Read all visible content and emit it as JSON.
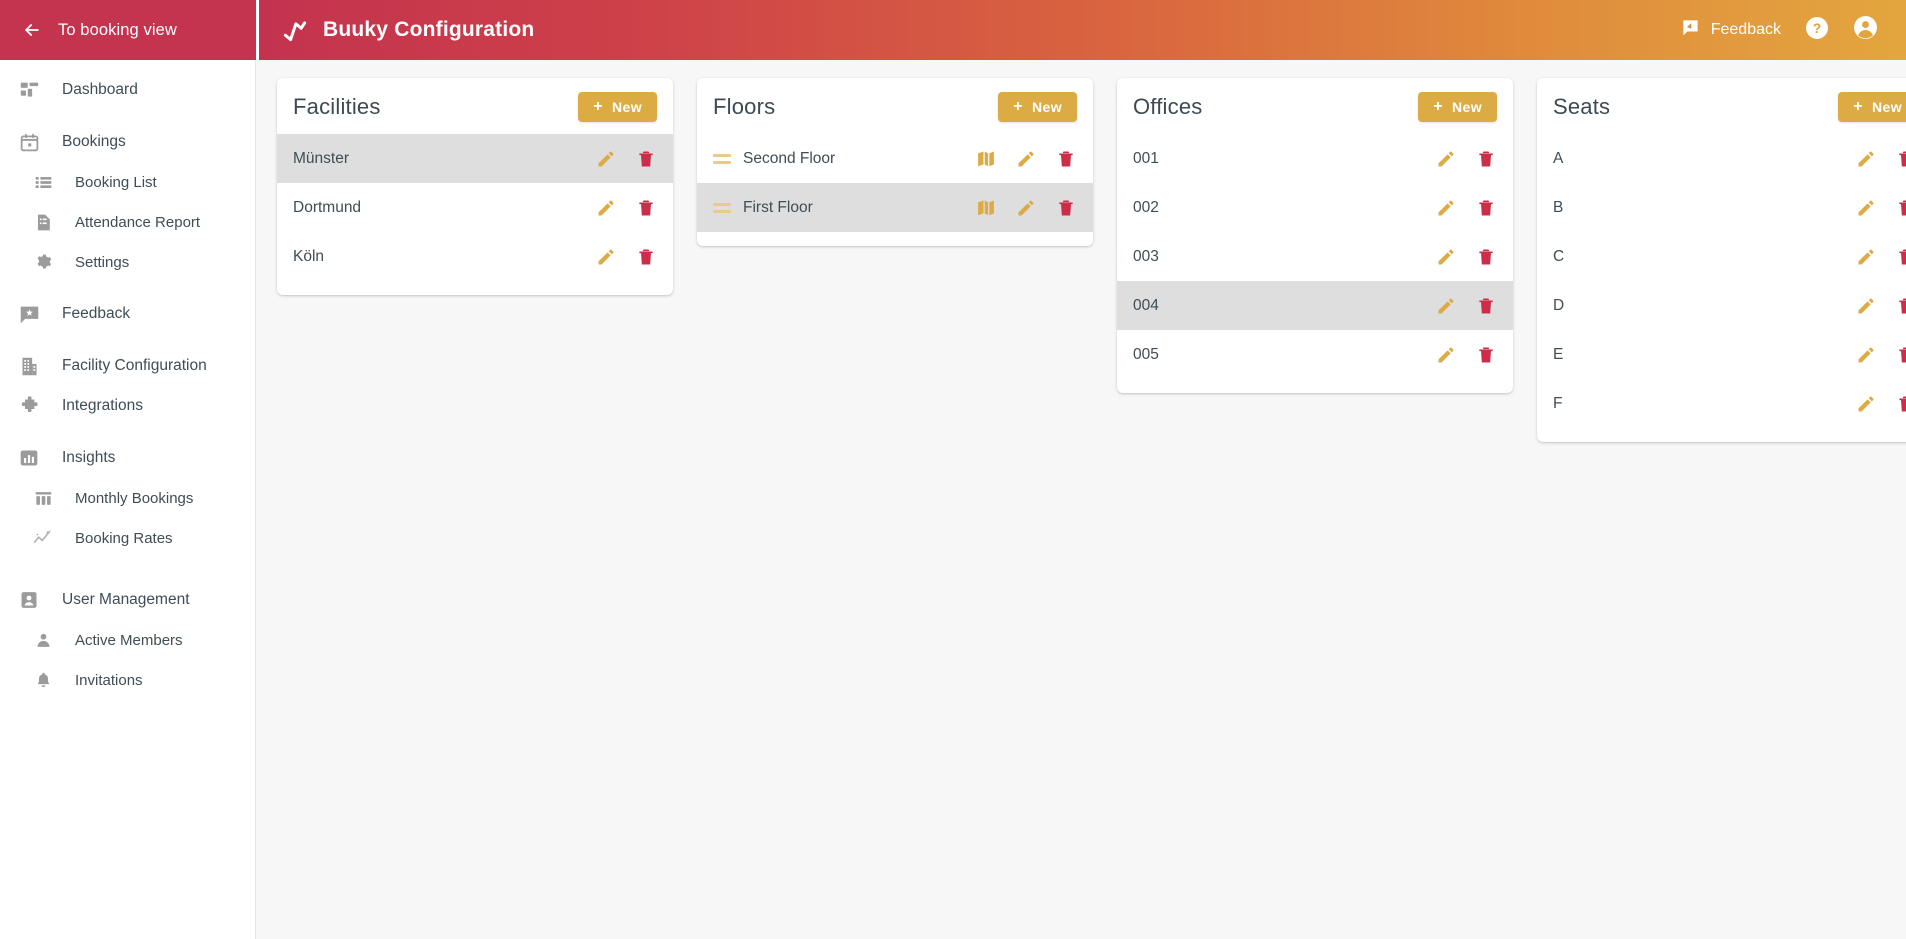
{
  "topbar": {
    "back_label": "To booking view",
    "back_icon": "arrow-left-icon",
    "brand_logo_icon": "buuky-zigzag-logo",
    "brand_title": "Buuky Configuration",
    "feedback_label": "Feedback",
    "feedback_icon": "feedback-message-icon",
    "help_icon": "help-circle-icon",
    "account_icon": "account-circle-icon",
    "gradient_start": "#c4334e",
    "gradient_end": "#e3a63e",
    "sidebar_header_color": "#c4344f"
  },
  "sidebar": {
    "items": [
      {
        "label": "Dashboard",
        "icon": "dashboard-grid-icon",
        "level": "top"
      },
      {
        "label": "Bookings",
        "icon": "calendar-icon",
        "level": "top"
      },
      {
        "label": "Booking List",
        "icon": "list-icon",
        "level": "sub"
      },
      {
        "label": "Attendance Report",
        "icon": "document-report-icon",
        "level": "sub"
      },
      {
        "label": "Settings",
        "icon": "gear-icon",
        "level": "sub"
      },
      {
        "label": "Feedback",
        "icon": "feedback-message-icon",
        "level": "top"
      },
      {
        "label": "Facility Configuration",
        "icon": "building-icon",
        "level": "top"
      },
      {
        "label": "Integrations",
        "icon": "puzzle-piece-icon",
        "level": "top"
      },
      {
        "label": "Insights",
        "icon": "bar-chart-icon",
        "level": "top"
      },
      {
        "label": "Monthly Bookings",
        "icon": "column-chart-icon",
        "level": "sub"
      },
      {
        "label": "Booking Rates",
        "icon": "trend-line-icon",
        "level": "sub"
      },
      {
        "label": "User Management",
        "icon": "user-badge-icon",
        "level": "top"
      },
      {
        "label": "Active Members",
        "icon": "person-icon",
        "level": "sub"
      },
      {
        "label": "Invitations",
        "icon": "bell-icon",
        "level": "sub"
      }
    ]
  },
  "cards": {
    "facilities": {
      "title": "Facilities",
      "new_label": "New",
      "rows": [
        {
          "label": "Münster",
          "selected": true
        },
        {
          "label": "Dortmund",
          "selected": false
        },
        {
          "label": "Köln",
          "selected": false
        }
      ]
    },
    "floors": {
      "title": "Floors",
      "new_label": "New",
      "rows": [
        {
          "label": "Second Floor",
          "selected": false
        },
        {
          "label": "First Floor",
          "selected": true
        }
      ]
    },
    "offices": {
      "title": "Offices",
      "new_label": "New",
      "rows": [
        {
          "label": "001",
          "selected": false
        },
        {
          "label": "002",
          "selected": false
        },
        {
          "label": "003",
          "selected": false
        },
        {
          "label": "004",
          "selected": true
        },
        {
          "label": "005",
          "selected": false
        }
      ]
    },
    "seats": {
      "title": "Seats",
      "new_label": "New",
      "rows": [
        {
          "label": "A",
          "selected": false
        },
        {
          "label": "B",
          "selected": false
        },
        {
          "label": "C",
          "selected": false
        },
        {
          "label": "D",
          "selected": false
        },
        {
          "label": "E",
          "selected": false
        },
        {
          "label": "F",
          "selected": false
        }
      ]
    }
  },
  "icons": {
    "edit": "pencil-edit-icon",
    "delete": "trash-delete-icon",
    "map": "floor-map-icon",
    "drag": "drag-handle-icon"
  },
  "colors": {
    "accent_gold": "#ddab43",
    "accent_red": "#c4334e",
    "selected_row": "#dedede",
    "page_bg": "#f7f7f7",
    "text": "#3f4d55"
  }
}
